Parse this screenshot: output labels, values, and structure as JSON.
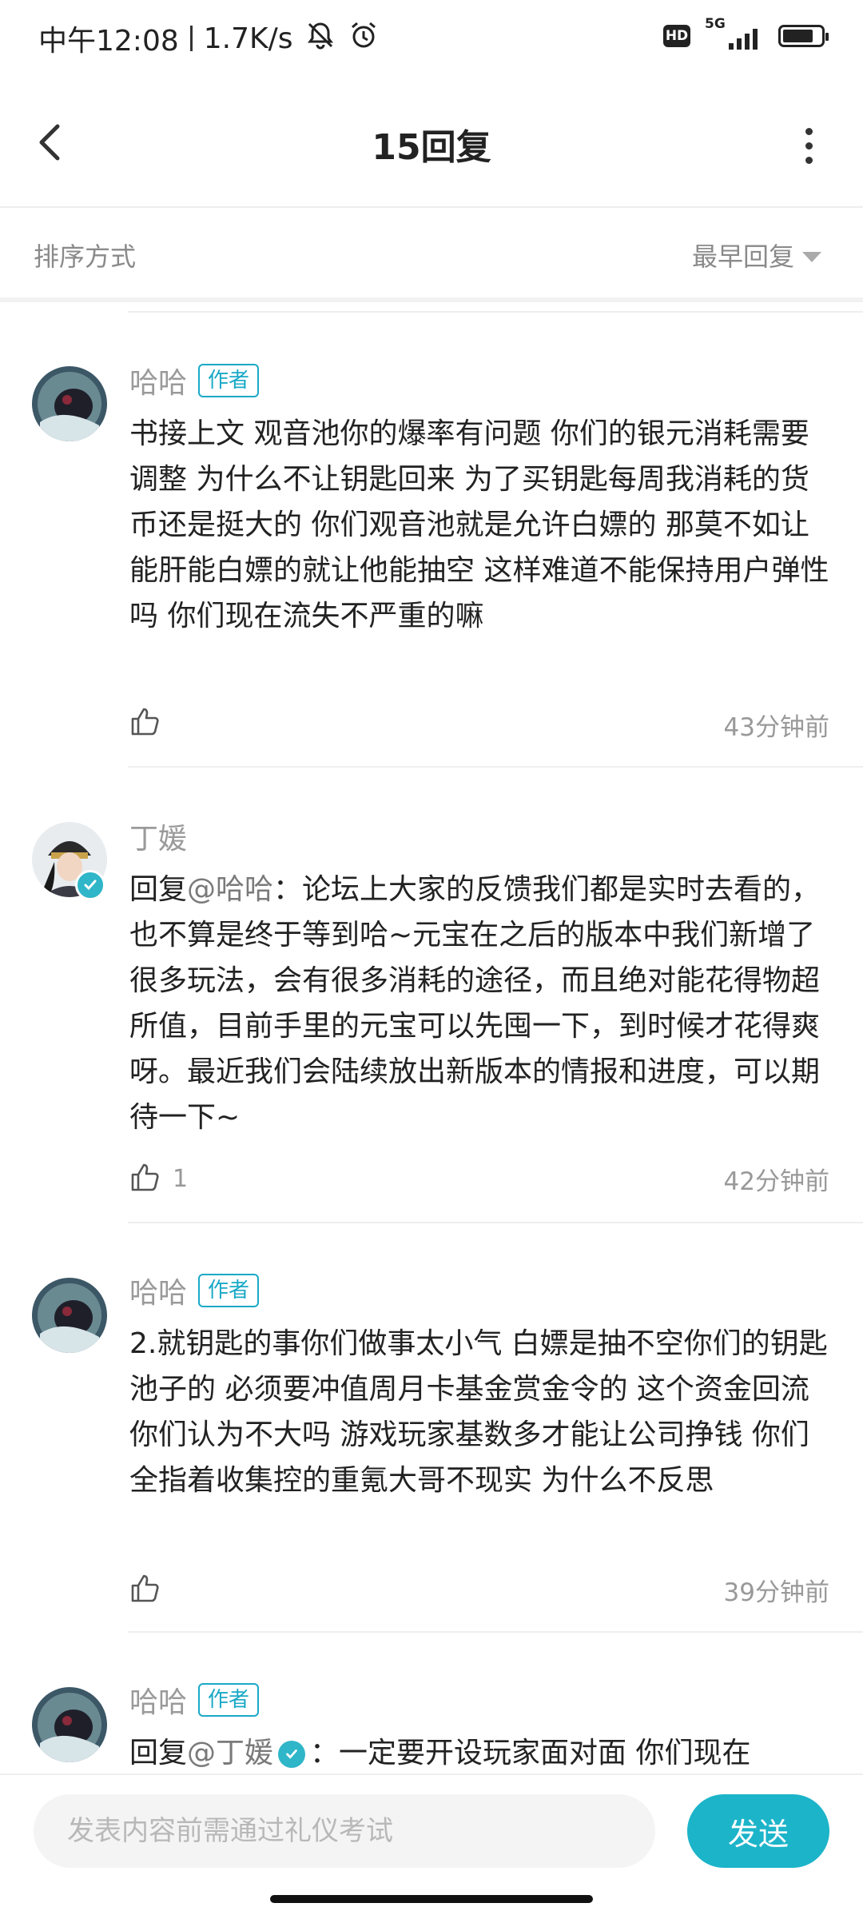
{
  "status_bar": {
    "time": "中午12:08",
    "net_speed": "1.7K/s",
    "hd_label": "HD",
    "network_label": "5G",
    "battery_level_percent": 80
  },
  "header": {
    "title": "15回复"
  },
  "sort": {
    "label": "排序方式",
    "value": "最早回复"
  },
  "comments": [
    {
      "username": "哈哈",
      "badge": "作者",
      "text": "书接上文 观音池你的爆率有问题 你们的银元消耗需要调整 为什么不让钥匙回来 为了买钥匙每周我消耗的货币还是挺大的 你们观音池就是允许白嫖的 那莫不如让能肝能白嫖的就让他能抽空 这样难道不能保持用户弹性吗 你们现在流失不严重的嘛",
      "likes": "",
      "time": "43分钟前"
    },
    {
      "username": "丁媛",
      "reply_prefix": "回复",
      "reply_to": "@哈哈",
      "text": "：论坛上大家的反馈我们都是实时去看的，也不算是终于等到哈~元宝在之后的版本中我们新增了很多玩法，会有很多消耗的途径，而且绝对能花得物超所值，目前手里的元宝可以先囤一下，到时候才花得爽呀。最近我们会陆续放出新版本的情报和进度，可以期待一下~",
      "likes": "1",
      "time": "42分钟前"
    },
    {
      "username": "哈哈",
      "badge": "作者",
      "text": "2.就钥匙的事你们做事太小气 白嫖是抽不空你们的钥匙池子的 必须要冲值周月卡基金赏金令的 这个资金回流你们认为不大吗 游戏玩家基数多才能让公司挣钱 你们全指着收集控的重氪大哥不现实 为什么不反思",
      "likes": "",
      "time": "39分钟前"
    },
    {
      "username": "哈哈",
      "badge": "作者",
      "reply_prefix": "回复",
      "reply_to": "@丁媛",
      "text": "：一定要开设玩家面对面 你们现在"
    }
  ],
  "input_bar": {
    "placeholder": "发表内容前需通过礼仪考试",
    "send_label": "发送"
  },
  "icons": {
    "back": "chevron-left-icon",
    "more": "more-vertical-icon",
    "sort": "caret-down-icon",
    "like": "thumbs-up-icon",
    "verified": "verified-check-icon",
    "silent": "bell-off-icon",
    "alarm": "alarm-clock-icon"
  },
  "colors": {
    "accent": "#1cb4c9",
    "badge": "#1aa9c7"
  }
}
